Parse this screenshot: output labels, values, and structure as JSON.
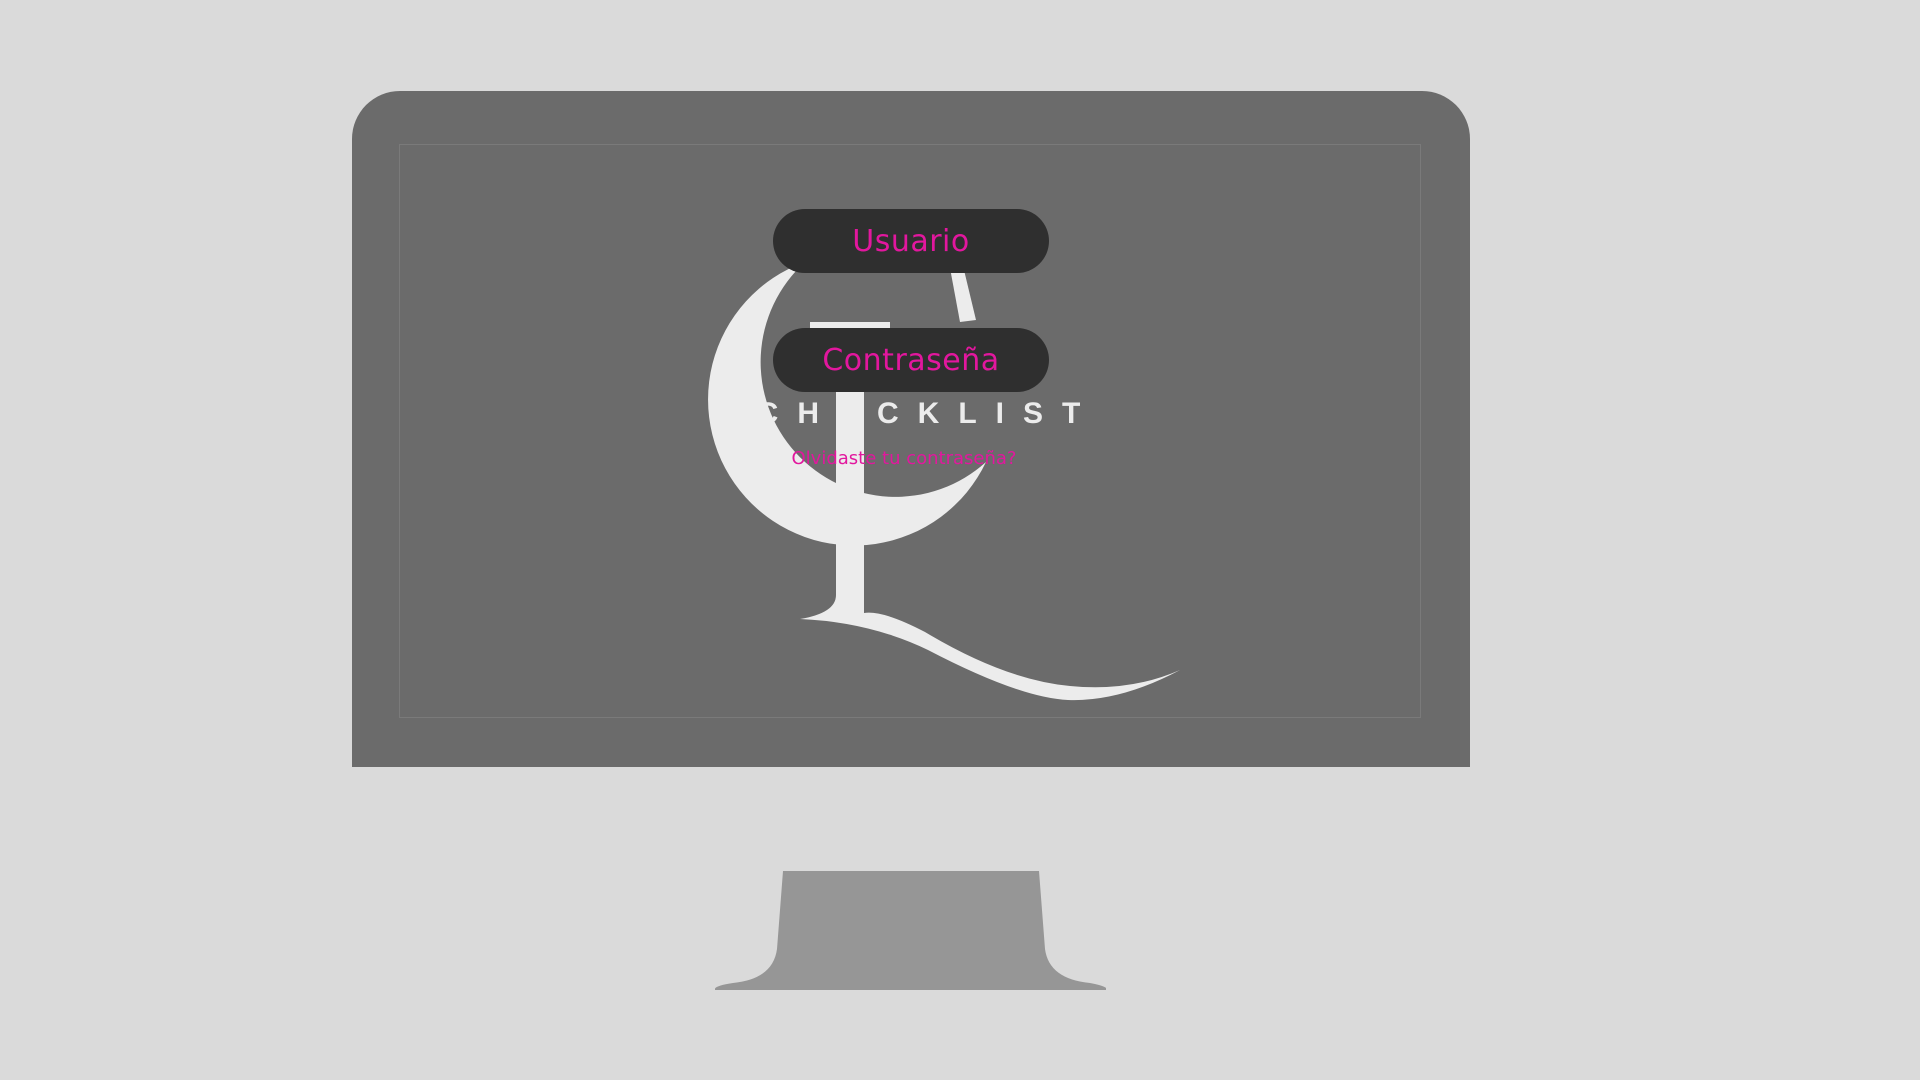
{
  "login": {
    "username_label": "Usuario",
    "password_label": "Contraseña",
    "forgot_password_link": "Olvidaste tu contraseña?"
  },
  "logo": {
    "wordmark": "CHECKLIST",
    "monogram": "CL"
  },
  "colors": {
    "background": "#dadada",
    "monitor": "#6b6b6b",
    "stand": "#969696",
    "field_background": "#2f2f2f",
    "accent": "#e2179e",
    "logo": "#ececec"
  },
  "icons": {
    "logo": "cl-monogram-logo",
    "device": "desktop-monitor"
  }
}
